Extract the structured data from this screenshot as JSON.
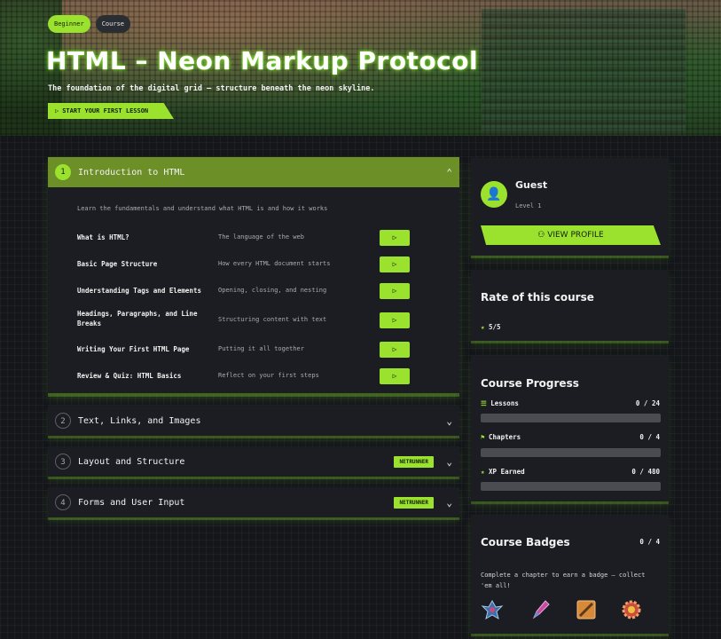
{
  "hero": {
    "tags": [
      "Beginner",
      "Course"
    ],
    "title": "HTML – Neon Markup Protocol",
    "subtitle": "The foundation of the digital grid – structure beneath the neon skyline.",
    "start_label": "START YOUR FIRST LESSON"
  },
  "chapters": [
    {
      "number": "1",
      "title": "Introduction to HTML",
      "description": "Learn the fundamentals and understand what HTML is and how it works",
      "lessons": [
        {
          "name": "What is HTML?",
          "sub": "The language of the web"
        },
        {
          "name": "Basic Page Structure",
          "sub": "How every HTML document starts"
        },
        {
          "name": "Understanding Tags and Elements",
          "sub": "Opening, closing, and nesting"
        },
        {
          "name": "Headings, Paragraphs, and Line Breaks",
          "sub": "Structuring content with text"
        },
        {
          "name": "Writing Your First HTML Page",
          "sub": "Putting it all together"
        },
        {
          "name": "Review & Quiz: HTML Basics",
          "sub": "Reflect on your first steps"
        }
      ]
    },
    {
      "number": "2",
      "title": "Text, Links, and Images"
    },
    {
      "number": "3",
      "title": "Layout and Structure",
      "badge": "NETRUNNER"
    },
    {
      "number": "4",
      "title": "Forms and User Input",
      "badge": "NETRUNNER"
    }
  ],
  "profile": {
    "name": "Guest",
    "level": "Level 1",
    "button_label": "VIEW PROFILE"
  },
  "rating": {
    "title": "Rate of this course",
    "value": "5/5"
  },
  "progress": {
    "title": "Course Progress",
    "items": [
      {
        "label": "Lessons",
        "value": "0 / 24",
        "fraction": 0
      },
      {
        "label": "Chapters",
        "value": "0 / 4",
        "fraction": 0
      },
      {
        "label": "XP Earned",
        "value": "0 / 480",
        "fraction": 0
      }
    ]
  },
  "badges": {
    "title": "Course Badges",
    "count": "0 / 4",
    "text": "Complete a chapter to earn a badge — collect 'em all!",
    "icons": [
      "winged-emblem-icon",
      "pen-icon",
      "scroll-icon",
      "gear-badge-icon"
    ]
  },
  "colors": {
    "accent": "#9be22f",
    "header_active": "#6c8f27",
    "panel": "#1b1d22"
  }
}
